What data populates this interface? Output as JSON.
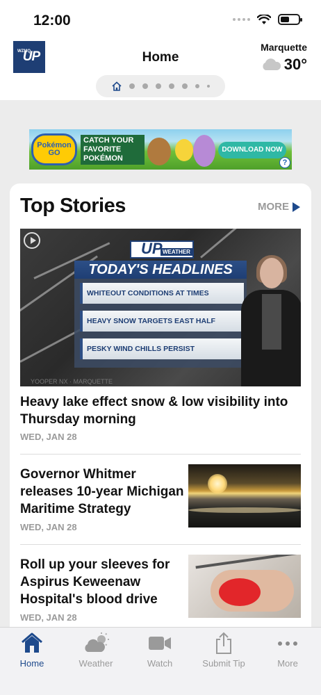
{
  "status_bar": {
    "time": "12:00"
  },
  "header": {
    "logo_text": "UP",
    "logo_small_text": "WZMQ",
    "title": "Home",
    "weather": {
      "city": "Marquette",
      "temperature": "30°",
      "icon": "cloud-icon"
    },
    "pager": {
      "active_icon": "home-icon",
      "dot_count": 7
    }
  },
  "ad": {
    "logo_text": "Pokémon GO",
    "headline": "CATCH YOUR FAVORITE POKÉMON",
    "button_label": "DOWNLOAD NOW",
    "info_icon": "?"
  },
  "top_stories": {
    "title": "Top Stories",
    "more_label": "MORE",
    "hero": {
      "badge_up": "UP",
      "badge_weather": "WEATHER",
      "banner": "TODAY'S HEADLINES",
      "headlines": [
        "WHITEOUT CONDITIONS AT TIMES",
        "HEAVY SNOW TARGETS EAST HALF",
        "PESKY WIND CHILLS PERSIST"
      ],
      "footer": "YOOPER NX · MARQUETTE"
    },
    "stories": [
      {
        "title": "Heavy lake effect snow & low visibility into Thursday morning",
        "date": "WED, JAN 28"
      },
      {
        "title": "Governor Whitmer releases 10-year Michigan Maritime Strategy",
        "date": "WED, JAN 28"
      },
      {
        "title": "Roll up your sleeves for Aspirus Keweenaw Hospital's blood drive",
        "date": "WED, JAN 28"
      }
    ]
  },
  "tabbar": {
    "active_color": "#1e4a8c",
    "tabs": [
      {
        "label": "Home",
        "icon": "home-icon"
      },
      {
        "label": "Weather",
        "icon": "partly-cloudy-icon"
      },
      {
        "label": "Watch",
        "icon": "video-camera-icon"
      },
      {
        "label": "Submit Tip",
        "icon": "share-upload-icon"
      },
      {
        "label": "More",
        "icon": "ellipsis-icon"
      }
    ]
  }
}
